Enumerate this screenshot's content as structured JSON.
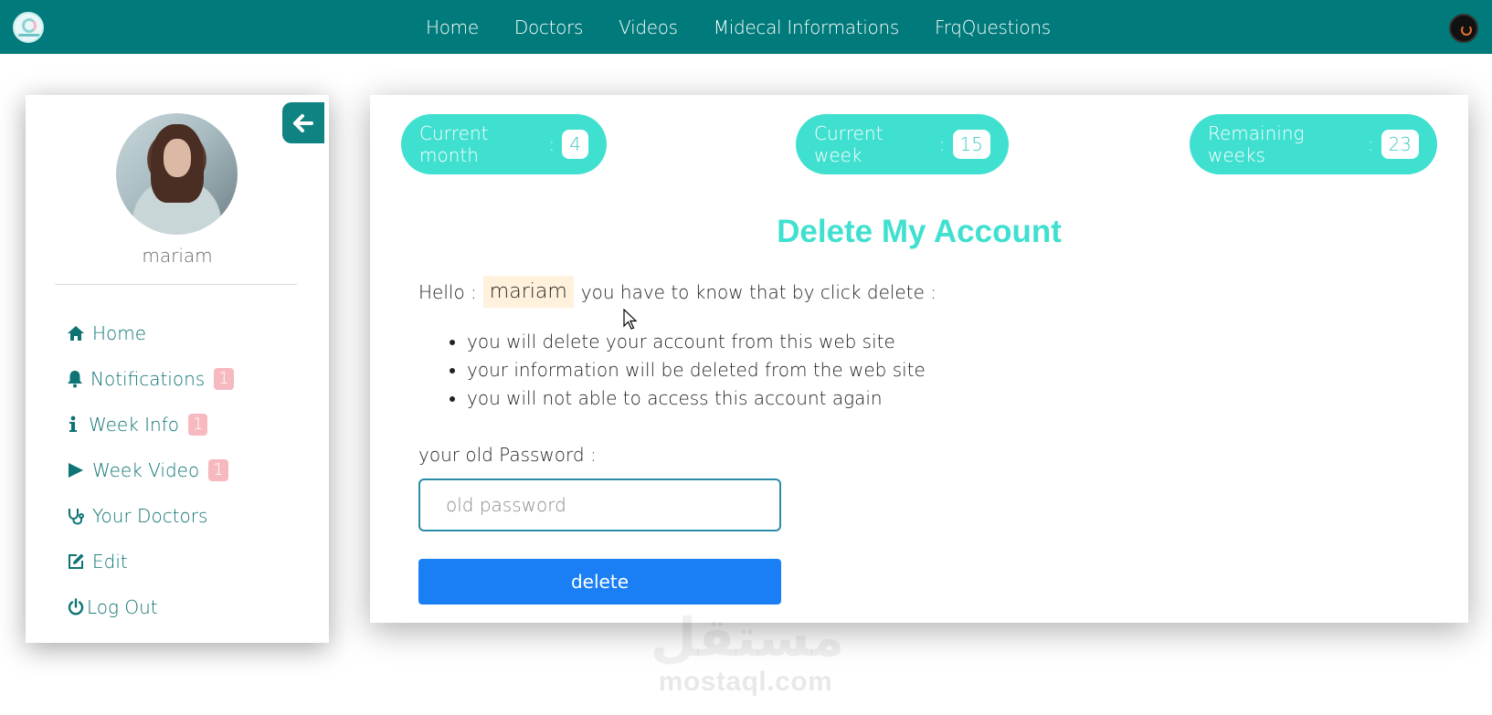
{
  "nav": {
    "links": [
      "Home",
      "Doctors",
      "Videos",
      "Midecal Informations",
      "FrqQuestions"
    ]
  },
  "sidebar": {
    "username": "mariam",
    "items": [
      {
        "label": "Home",
        "icon": "home-icon"
      },
      {
        "label": "Notifications",
        "icon": "bell-icon",
        "badge": "1"
      },
      {
        "label": "Week Info",
        "icon": "info-icon",
        "badge": "1"
      },
      {
        "label": "Week Video",
        "icon": "play-icon",
        "badge": "1"
      },
      {
        "label": "Your Doctors",
        "icon": "stethoscope-icon"
      },
      {
        "label": "Edit",
        "icon": "edit-icon"
      },
      {
        "label": "Log Out",
        "icon": "power-icon"
      }
    ]
  },
  "stats": {
    "current_month_label": "Current month",
    "current_month": "4",
    "current_week_label": "Current week",
    "current_week": "15",
    "remaining_weeks_label": "Remaining weeks",
    "remaining_weeks": "23"
  },
  "delete_page": {
    "title": "Delete My Account",
    "hello_prefix": "Hello :",
    "name": "mariam",
    "hello_suffix": "you have to know that by click delete :",
    "warnings": [
      "you will delete your account from this web site",
      "your information will be deleted from the web site",
      "you will not able to access this account again"
    ],
    "password_label": "your old Password :",
    "password_placeholder": "old password",
    "delete_label": "delete"
  },
  "watermark": {
    "arabic": "مستقل",
    "text": "mostaql.com"
  },
  "colors": {
    "nav_bg": "#007a7a",
    "accent": "#40e0d0",
    "sidebar_text": "#0e7373",
    "badge": "#f7b9c0",
    "button": "#1a7ff5"
  }
}
